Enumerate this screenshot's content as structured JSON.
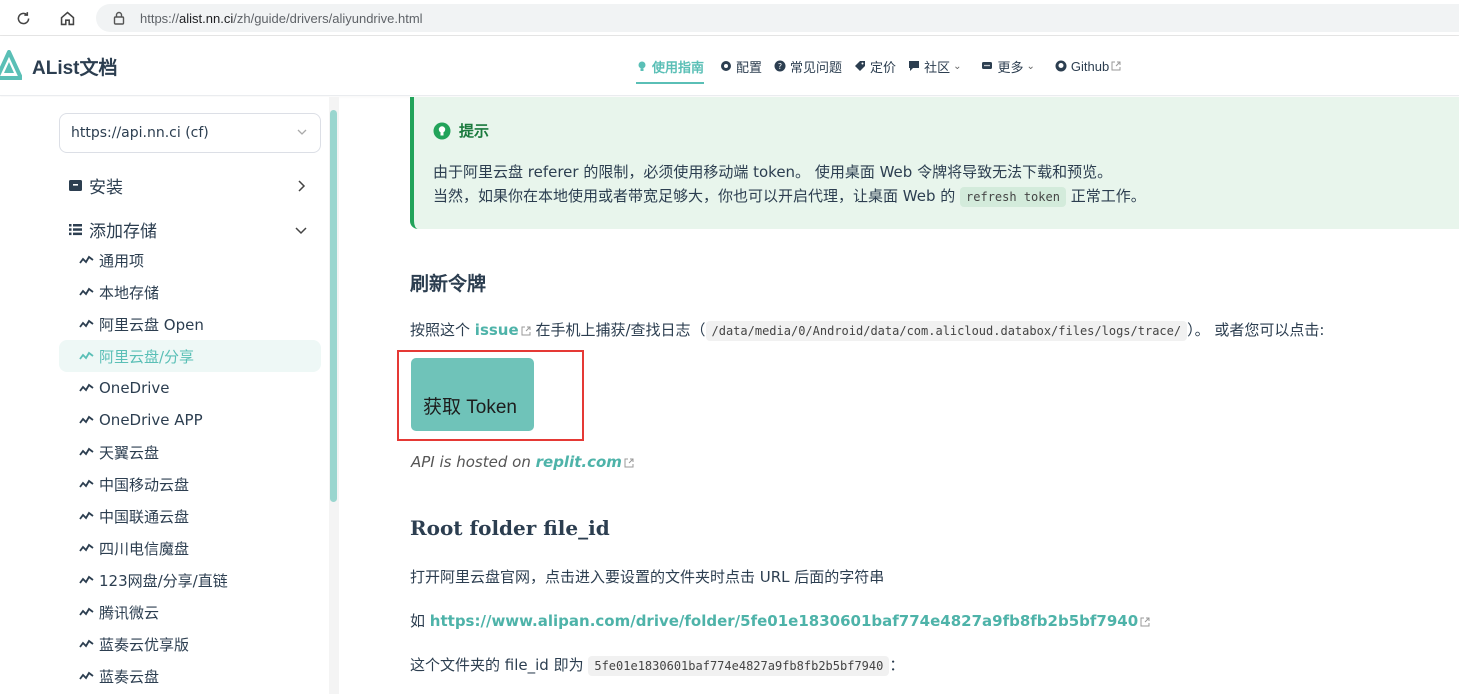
{
  "browser": {
    "url_prefix": "https://",
    "url_host": "alist.nn.ci",
    "url_path": "/zh/guide/drivers/aliyundrive.html"
  },
  "site": {
    "brand": "AList文档",
    "nav": [
      {
        "label": "使用指南",
        "icon": "bulb-icon",
        "active": true
      },
      {
        "label": "配置",
        "icon": "gear-icon"
      },
      {
        "label": "常见问题",
        "icon": "question-icon"
      },
      {
        "label": "定价",
        "icon": "tag-icon"
      },
      {
        "label": "社区",
        "icon": "chat-icon",
        "dropdown": true
      },
      {
        "label": "更多",
        "icon": "message-icon",
        "dropdown": true
      },
      {
        "label": "Github",
        "icon": "github-icon",
        "external": true
      }
    ]
  },
  "sidebar": {
    "api_select": "https://api.nn.ci (cf)",
    "groups": [
      {
        "label": "安装",
        "icon": "box-icon",
        "expanded": false
      },
      {
        "label": "添加存储",
        "icon": "list-icon",
        "expanded": true
      }
    ],
    "items": [
      "通用项",
      "本地存储",
      "阿里云盘 Open",
      "阿里云盘/分享",
      "OneDrive",
      "OneDrive APP",
      "天翼云盘",
      "中国移动云盘",
      "中国联通云盘",
      "四川电信魔盘",
      "123网盘/分享/直链",
      "腾讯微云",
      "蓝奏云优享版",
      "蓝奏云盘"
    ],
    "active_item": "阿里云盘/分享"
  },
  "tip": {
    "title": "提示",
    "line1": "由于阿里云盘 referer 的限制，必须使用移动端 token。 使用桌面 Web 令牌将导致无法下载和预览。",
    "line2_before": "当然，如果你在本地使用或者带宽足够大，你也可以开启代理，让桌面 Web 的",
    "line2_code": "refresh token",
    "line2_after": "正常工作。"
  },
  "section1": {
    "heading": "刷新令牌",
    "before": "按照这个",
    "link": "issue",
    "middle": "在手机上捕获/查找日志（",
    "code": "/data/media/0/Android/data/com.alicloud.databox/files/logs/trace/",
    "after": "）。 或者您可以点击:",
    "button": "获取 Token",
    "hosted_prefix": "API is hosted on",
    "hosted_link": "replit.com"
  },
  "section2": {
    "heading": "Root folder file_id",
    "p1": "打开阿里云盘官网，点击进入要设置的文件夹时点击 URL 后面的字符串",
    "p2_prefix": "如",
    "p2_link": "https://www.alipan.com/drive/folder/5fe01e1830601baf774e4827a9fb8fb2b5bf7940",
    "p3_before": "这个文件夹的 file_id 即为",
    "p3_code": "5fe01e1830601baf774e4827a9fb8fb2b5bf7940",
    "p3_after": "："
  },
  "colors": {
    "accent": "#5abfb6",
    "tip_border": "#22a35a",
    "tip_bg": "#e8f5ec",
    "highlight": "#e53935"
  }
}
